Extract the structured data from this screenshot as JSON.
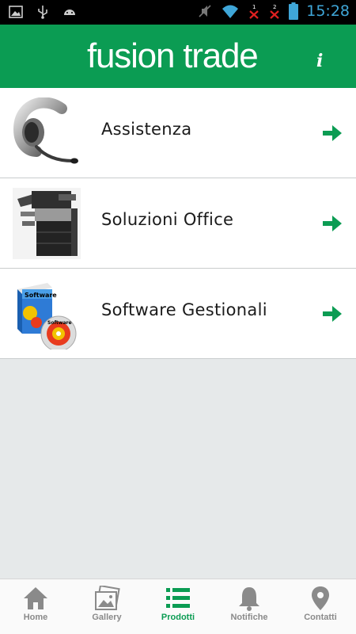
{
  "status_bar": {
    "time": "15:28",
    "left_icons": [
      "image-icon",
      "usb-icon",
      "android-icon"
    ],
    "right_icons": [
      "muted-icon",
      "wifi-icon",
      "sim1-no-signal-icon",
      "sim2-no-signal-icon",
      "battery-icon"
    ],
    "sim1": "1",
    "sim2": "2"
  },
  "header": {
    "brand": "fusion trade",
    "info_label": "i",
    "color": "#0b9c53"
  },
  "list": {
    "items": [
      {
        "label": "Assistenza",
        "icon": "headset-icon"
      },
      {
        "label": "Soluzioni Office",
        "icon": "printer-icon"
      },
      {
        "label": "Software Gestionali",
        "icon": "software-box-icon"
      }
    ]
  },
  "bottom_nav": {
    "items": [
      {
        "label": "Home",
        "icon": "home-icon",
        "active": false
      },
      {
        "label": "Gallery",
        "icon": "gallery-icon",
        "active": false
      },
      {
        "label": "Prodotti",
        "icon": "list-icon",
        "active": true
      },
      {
        "label": "Notifiche",
        "icon": "bell-icon",
        "active": false
      },
      {
        "label": "Contatti",
        "icon": "location-pin-icon",
        "active": false
      }
    ]
  },
  "colors": {
    "accent": "#0b9c53",
    "nav_inactive": "#8a8a8a",
    "clock": "#3fa6d8"
  }
}
